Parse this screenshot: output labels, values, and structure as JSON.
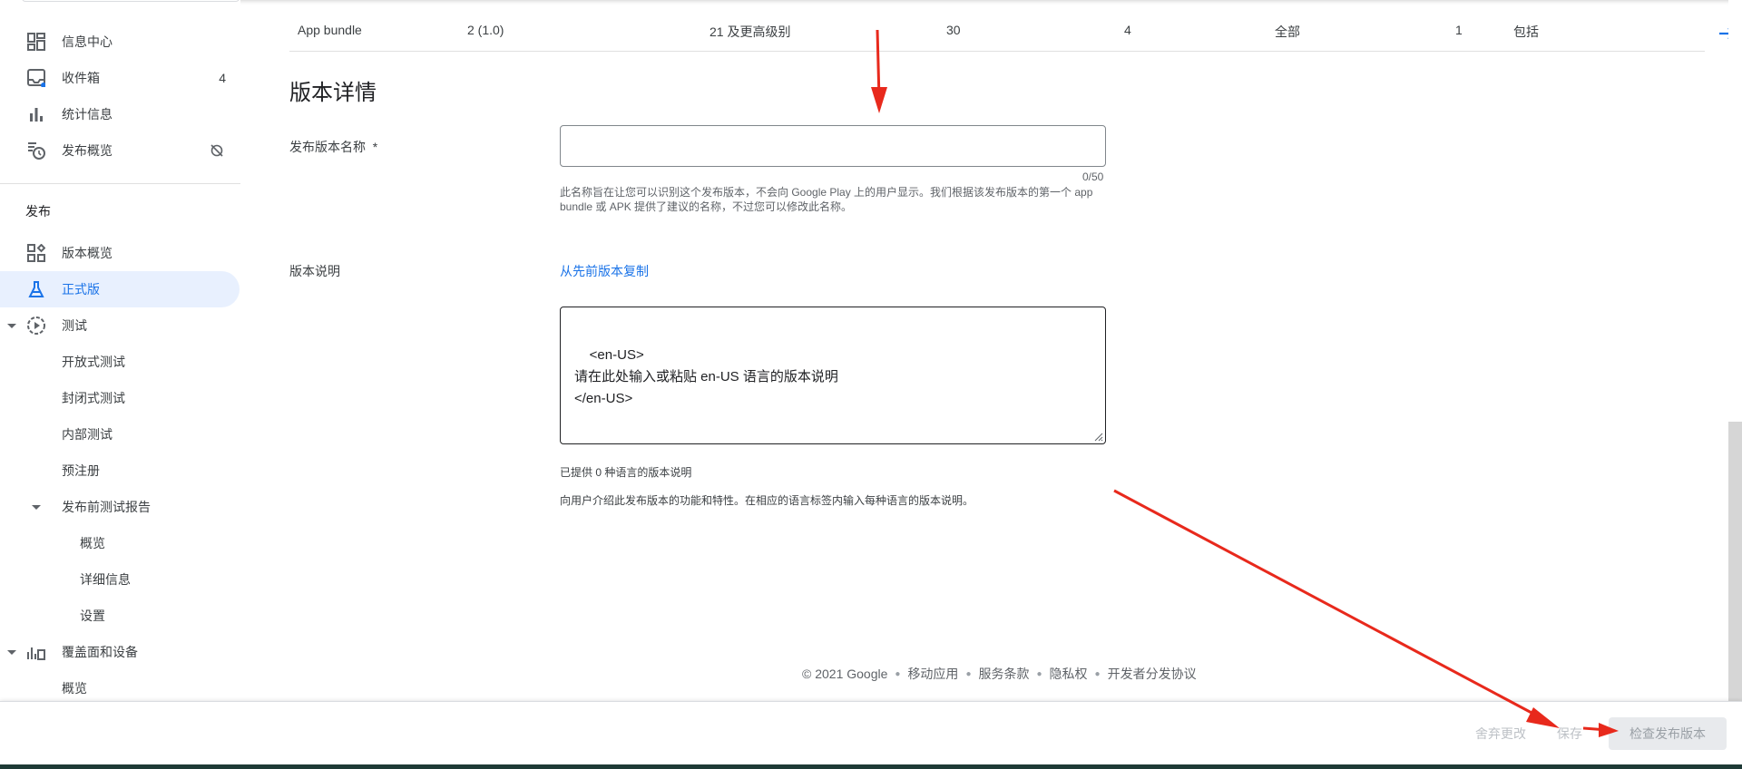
{
  "sidebar": {
    "items_top": [
      {
        "label": "信息中心",
        "icon": "dashboard-icon"
      },
      {
        "label": "收件箱",
        "icon": "inbox-icon",
        "count": "4"
      },
      {
        "label": "统计信息",
        "icon": "bar-chart-icon"
      },
      {
        "label": "发布概览",
        "icon": "publishing-overview-icon"
      }
    ],
    "section_label": "发布",
    "items_release": [
      {
        "label": "版本概览",
        "icon": "release-overview-icon"
      },
      {
        "label": "正式版",
        "icon": "production-icon"
      },
      {
        "label": "测试",
        "icon": "testing-icon"
      },
      {
        "label": "开放式测试"
      },
      {
        "label": "封闭式测试"
      },
      {
        "label": "内部测试"
      },
      {
        "label": "预注册"
      },
      {
        "label": "发布前测试报告"
      },
      {
        "label": "概览"
      },
      {
        "label": "详细信息"
      },
      {
        "label": "设置"
      },
      {
        "label": "覆盖面和设备",
        "icon": "reach-devices-icon"
      },
      {
        "label": "概览"
      }
    ]
  },
  "table_row": {
    "type": "App bundle",
    "version": "2 (1.0)",
    "api_level": "21 及更高级别",
    "target_sdk": "30",
    "screen_layouts": "4",
    "abis": "全部",
    "features": "1",
    "status": "包括"
  },
  "details": {
    "title": "版本详情",
    "name_label": "发布版本名称",
    "required_mark": "*",
    "name_value": "",
    "name_counter": "0/50",
    "name_helper": "此名称旨在让您可以识别这个发布版本，不会向 Google Play 上的用户显示。我们根据该发布版本的第一个 app bundle 或 APK 提供了建议的名称，不过您可以修改此名称。",
    "notes_label": "版本说明",
    "copy_link": "从先前版本复制",
    "notes_text": "<en-US>\n请在此处输入或粘贴 en-US 语言的版本说明\n</en-US>",
    "notes_count": "已提供 0 种语言的版本说明",
    "notes_help": "向用户介绍此发布版本的功能和特性。在相应的语言标签内输入每种语言的版本说明。"
  },
  "footer": {
    "copyright": "© 2021 Google",
    "links": [
      "移动应用",
      "服务条款",
      "隐私权",
      "开发者分发协议"
    ]
  },
  "bottom_bar": {
    "discard": "舍弃更改",
    "save": "保存",
    "review": "检查发布版本"
  },
  "colors": {
    "accent": "#1a73e8",
    "annotation": "#e8291c"
  }
}
